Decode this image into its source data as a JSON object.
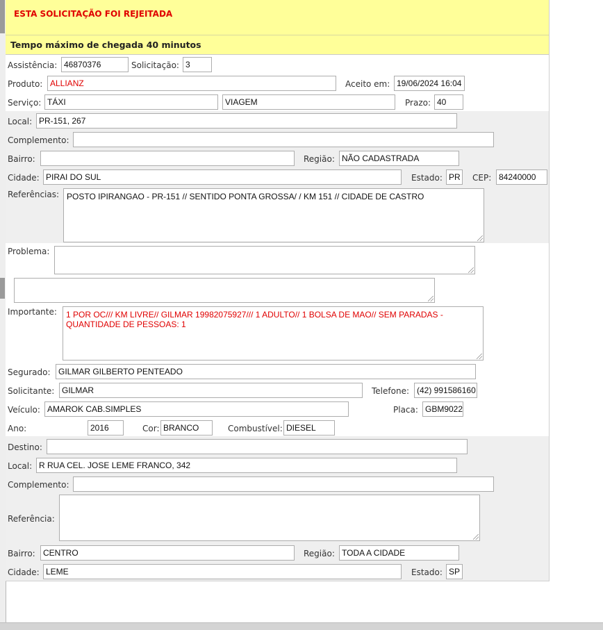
{
  "alert": {
    "text": "ESTA SOLICITAÇÃO FOI REJEITADA"
  },
  "tempo": {
    "text": "Tempo máximo de chegada 40 minutos"
  },
  "form": {
    "assistencia": {
      "label": "Assistência:",
      "value": "46870376"
    },
    "solicitacao": {
      "label": "Solicitação:",
      "value": "3"
    },
    "produto": {
      "label": "Produto:",
      "value": "ALLIANZ"
    },
    "aceito_em": {
      "label": "Aceito em:",
      "value": "19/06/2024 16:04"
    },
    "servico": {
      "label": "Serviço:",
      "value": "TÁXI",
      "value2": "VIAGEM"
    },
    "prazo": {
      "label": "Prazo:",
      "value": "40"
    },
    "local": {
      "label": "Local:",
      "value": "PR-151, 267"
    },
    "complemento": {
      "label": "Complemento:",
      "value": ""
    },
    "bairro": {
      "label": "Bairro:",
      "value": ""
    },
    "regiao": {
      "label": "Região:",
      "value": "NÃO CADASTRADA"
    },
    "cidade": {
      "label": "Cidade:",
      "value": "PIRAI DO SUL"
    },
    "estado": {
      "label": "Estado:",
      "value": "PR"
    },
    "cep": {
      "label": "CEP:",
      "value": "84240000"
    },
    "referencias": {
      "label": "Referências:",
      "value": "POSTO IPIRANGAO - PR-151  // SENTIDO PONTA GROSSA/ /  KM 151 // CIDADE DE CASTRO"
    },
    "problema": {
      "label": "Problema:",
      "value": "",
      "value2": ""
    },
    "importante": {
      "label": "Importante:",
      "value": "1 POR OC/// KM LIVRE// GILMAR 19982075927/// 1 ADULTO// 1 BOLSA DE MAO// SEM PARADAS - QUANTIDADE DE PESSOAS: 1"
    },
    "segurado": {
      "label": "Segurado:",
      "value": "GILMAR GILBERTO PENTEADO"
    },
    "solicitante": {
      "label": "Solicitante:",
      "value": "GILMAR"
    },
    "telefone": {
      "label": "Telefone:",
      "value": "(42) 991586160"
    },
    "veiculo": {
      "label": "Veículo:",
      "value": "AMAROK CAB.SIMPLES"
    },
    "placa": {
      "label": "Placa:",
      "value": "GBM9022"
    },
    "ano": {
      "label": "Ano:",
      "value": "2016"
    },
    "cor": {
      "label": "Cor:",
      "value": "BRANCO"
    },
    "combustivel": {
      "label": "Combustível:",
      "value": "DIESEL"
    }
  },
  "destino": {
    "destino": {
      "label": "Destino:",
      "value": ""
    },
    "local": {
      "label": "Local:",
      "value": "R RUA CEL. JOSE LEME FRANCO, 342"
    },
    "complemento": {
      "label": "Complemento:",
      "value": ""
    },
    "referencia": {
      "label": "Referência:",
      "value": ""
    },
    "bairro": {
      "label": "Bairro:",
      "value": "CENTRO"
    },
    "regiao": {
      "label": "Região:",
      "value": "TODA A CIDADE"
    },
    "cidade": {
      "label": "Cidade:",
      "value": "LEME"
    },
    "estado": {
      "label": "Estado:",
      "value": "SP"
    }
  }
}
